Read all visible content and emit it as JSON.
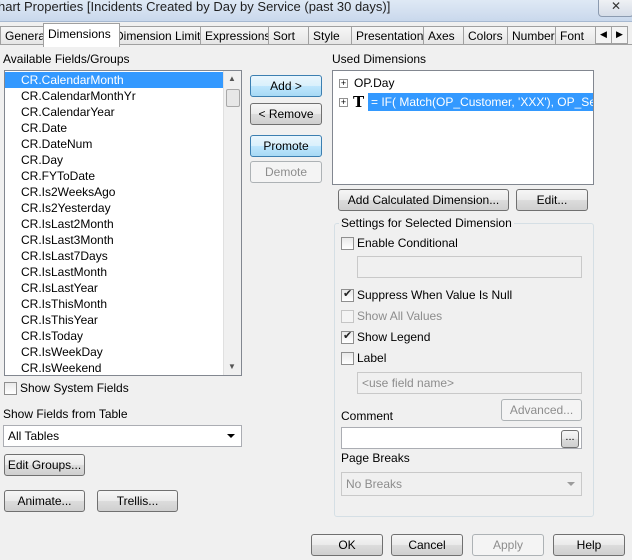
{
  "window": {
    "title": "hart Properties [Incidents Created by Day by Service (past 30 days)]",
    "close": "✕"
  },
  "tabs": [
    {
      "label": "General"
    },
    {
      "label": "Dimensions"
    },
    {
      "label": "Dimension Limits"
    },
    {
      "label": "Expressions"
    },
    {
      "label": "Sort"
    },
    {
      "label": "Style"
    },
    {
      "label": "Presentation"
    },
    {
      "label": "Axes"
    },
    {
      "label": "Colors"
    },
    {
      "label": "Number"
    },
    {
      "label": "Font"
    }
  ],
  "available": {
    "label": "Available Fields/Groups",
    "items": [
      "CR.CalendarMonth",
      "CR.CalendarMonthYr",
      "CR.CalendarYear",
      "CR.Date",
      "CR.DateNum",
      "CR.Day",
      "CR.FYToDate",
      "CR.Is2WeeksAgo",
      "CR.Is2Yesterday",
      "CR.IsLast2Month",
      "CR.IsLast3Month",
      "CR.IsLast7Days",
      "CR.IsLastMonth",
      "CR.IsLastYear",
      "CR.IsThisMonth",
      "CR.IsThisYear",
      "CR.IsToday",
      "CR.IsWeekDay",
      "CR.IsWeekend"
    ],
    "selected_index": 0,
    "show_system_fields": "Show System Fields",
    "show_fields_from_table": "Show Fields from Table",
    "table_value": "All Tables"
  },
  "buttons": {
    "add": "Add >",
    "remove": "< Remove",
    "promote": "Promote",
    "demote": "Demote",
    "add_calculated": "Add Calculated Dimension...",
    "edit": "Edit...",
    "edit_groups": "Edit Groups...",
    "animate": "Animate...",
    "trellis": "Trellis...",
    "advanced": "Advanced...",
    "ellipsis": "...",
    "ok": "OK",
    "cancel": "Cancel",
    "apply": "Apply",
    "help": "Help"
  },
  "used": {
    "label": "Used Dimensions",
    "items": [
      {
        "text": "OP.Day",
        "icon": "none"
      },
      {
        "text": "= IF( Match(OP_Customer, 'XXX'), OP_Severity",
        "icon": "T"
      }
    ]
  },
  "settings": {
    "label": "Settings for Selected Dimension",
    "enable_conditional": "Enable Conditional",
    "suppress_null": "Suppress When Value Is Null",
    "show_all_values": "Show All Values",
    "show_legend": "Show Legend",
    "label_cb": "Label",
    "label_placeholder": "<use field name>",
    "comment": "Comment",
    "page_breaks": "Page Breaks",
    "page_breaks_value": "No Breaks"
  }
}
